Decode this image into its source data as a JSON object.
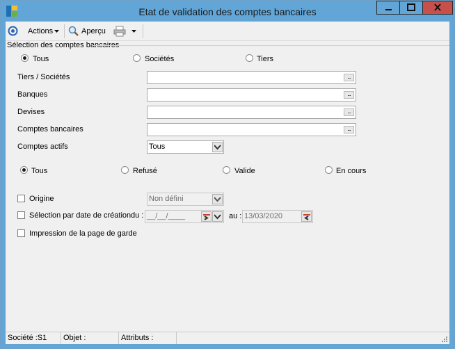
{
  "window": {
    "title": "Etat de validation des comptes bancaires"
  },
  "toolbar": {
    "actions_label": "Actions",
    "apercu_label": "Aperçu"
  },
  "selection": {
    "section_title": "Sélection des comptes bancaires",
    "radios": [
      "Tous",
      "Sociétés",
      "Tiers"
    ],
    "selected": "Tous"
  },
  "fields": {
    "tiers_label": "Tiers / Sociétés",
    "tiers_value": "",
    "banques_label": "Banques",
    "banques_value": "",
    "devises_label": "Devises",
    "devises_value": "",
    "comptes_label": "Comptes bancaires",
    "comptes_value": "",
    "actifs_label": "Comptes actifs",
    "actifs_value": "Tous"
  },
  "status_filter": {
    "radios": [
      "Tous",
      "Refusé",
      "Valide",
      "En cours"
    ],
    "selected": "Tous"
  },
  "options": {
    "origine_label": "Origine",
    "origine_value": "Non défini",
    "date_label": "Sélection par date de création",
    "du_label": "du :",
    "du_value": "__/__/____",
    "au_label": "au :",
    "au_value": "13/03/2020",
    "garde_label": "Impression de la page de garde"
  },
  "statusbar": {
    "societe": "Société :S1",
    "objet": "Objet :",
    "attributs": "Attributs :"
  }
}
